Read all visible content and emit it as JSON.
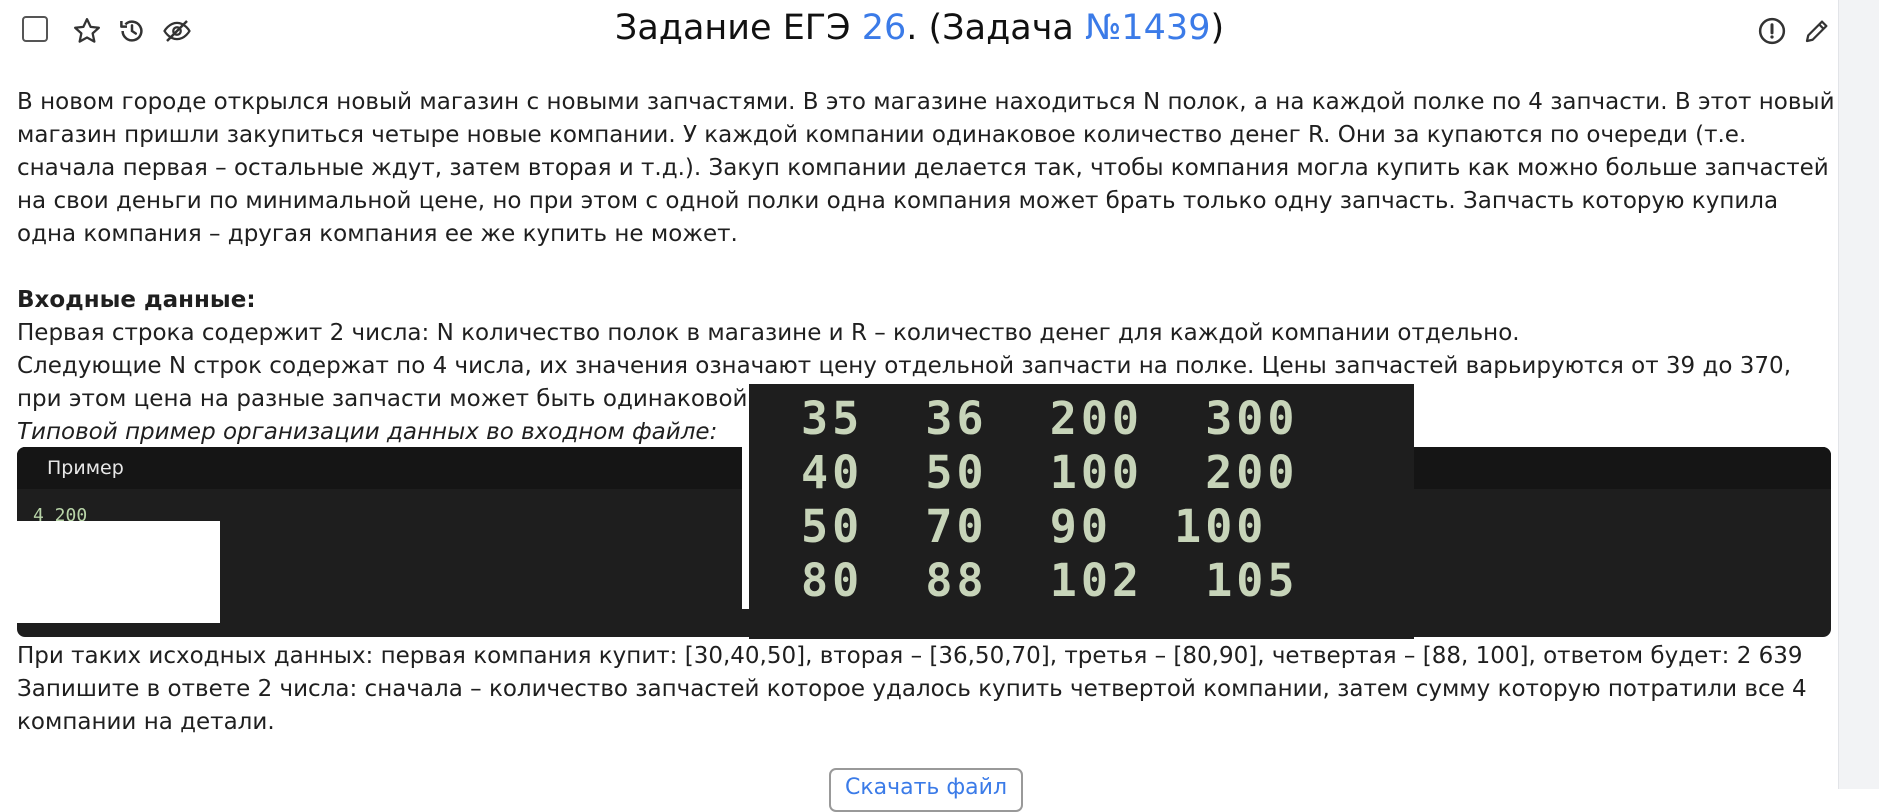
{
  "header": {
    "title_prefix": "Задание ЕГЭ ",
    "task_number": "26",
    "title_middle": ". (Задача ",
    "problem_id": "№1439",
    "title_suffix": ")"
  },
  "icons": {
    "checkbox": "checkbox-icon",
    "star": "star-icon",
    "history": "history-icon",
    "hide": "eye-off-icon",
    "report": "exclamation-circle-icon",
    "edit": "pencil-icon"
  },
  "body": {
    "paragraph1": "В новом городе открылся новый магазин с новыми запчастями. В это магазине находиться N полок, а на каждой полке по 4 запчасти. В этот новый магазин пришли закупиться четыре новые компании. У каждой компании одинаковое количество денег R. Они за купаются по очереди (т.е. сначала первая – остальные ждут, затем вторая и т.д.). Закуп компании делается так, чтобы компания могла купить как можно больше запчастей на свои деньги по минимальной цене, но при этом с одной полки одна компания может брать только одну запчасть. Запчасть которую купила одна компания – другая компания ее же купить не может.",
    "input_heading": "Входные данные:",
    "input_line1": "Первая строка содержит 2 числа: N количество полок в магазине и R – количество денег для каждой компании отдельно.",
    "input_line2": "Следующие N строк содержат по 4 числа, их значения означают цену отдельной запчасти на полке. Цены запчастей варьируются от 39 до 370, при этом цена на разные запчасти может быть одинаковой.",
    "example_caption": "Типовой пример организации данных во входном файле:"
  },
  "example": {
    "tab_label": "Пример",
    "first_line": "4 200",
    "rows": [
      "35  36  200  300",
      "40  50  100  200",
      "50  70  90  100",
      "80  88  102  105"
    ]
  },
  "after": {
    "result_line": "При таких исходных данных: первая компания купит: [30,40,50], вторая – [36,50,70], третья – [80,90], четвертая – [88, 100], ответом будет: 2   639",
    "answer_line": "Запишите в ответе 2 числа: сначала – количество запчастей которое удалось купить четвертой компании, затем сумму которую потратили все 4 компании на детали."
  },
  "file_button_label": "Скачать файл",
  "colors": {
    "link": "#3b7be8",
    "code_bg": "#1e1e1e",
    "code_text": "#c7d4b9"
  }
}
